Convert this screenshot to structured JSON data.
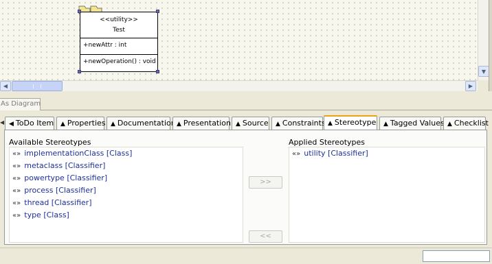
{
  "diagram": {
    "class": {
      "stereotype": "<<utility>>",
      "name": "Test",
      "attribute": "+newAttr : int",
      "operation": "+newOperation() : void"
    },
    "tab_label": "As Diagram"
  },
  "details": {
    "tabs": [
      {
        "label": "ToDo Item",
        "active": false
      },
      {
        "label": "Properties",
        "active": false
      },
      {
        "label": "Documentation",
        "active": false
      },
      {
        "label": "Presentation",
        "active": false
      },
      {
        "label": "Source",
        "active": false
      },
      {
        "label": "Constraints",
        "active": false
      },
      {
        "label": "Stereotype",
        "active": true
      },
      {
        "label": "Tagged Values",
        "active": false
      },
      {
        "label": "Checklist",
        "active": false
      }
    ],
    "stereotype_panel": {
      "available_title": "Available Stereotypes",
      "applied_title": "Applied Stereotypes",
      "available": [
        "implementationClass [Class]",
        "metaclass [Classifier]",
        "powertype [Classifier]",
        "process [Classifier]",
        "thread [Classifier]",
        "type [Class]"
      ],
      "applied": [
        "utility [Classifier]"
      ],
      "stereotype_marker": "«»",
      "add_button": ">>",
      "remove_button": "<<"
    }
  },
  "colors": {
    "active_tab_accent": "#e8a317",
    "list_text": "#1c2fa0",
    "selection_handle": "#6a6aa8"
  }
}
